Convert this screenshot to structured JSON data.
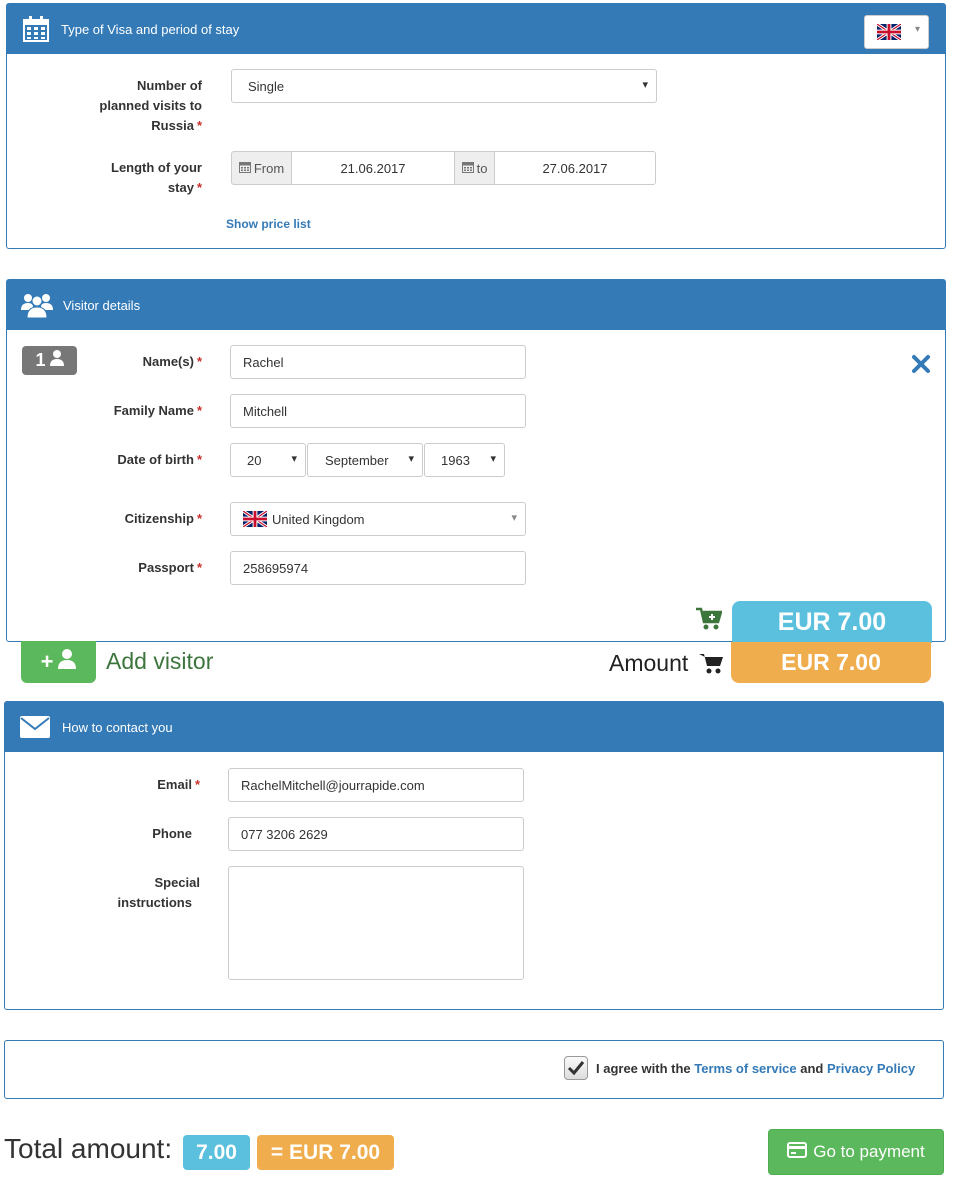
{
  "visa_panel": {
    "title": "Type of Visa and period of stay",
    "visits_label": "Number of planned visits to Russia",
    "visits_value": "Single",
    "stay_label": "Length of your stay",
    "from_label": "From",
    "from_date": "21.06.2017",
    "to_label": "to",
    "to_date": "27.06.2017",
    "price_list_link": "Show price list",
    "language_flag": "uk-flag-icon"
  },
  "visitor_panel": {
    "title": "Visitor details",
    "visitor_number": "1",
    "name_label": "Name(s)",
    "name_value": "Rachel",
    "family_label": "Family Name",
    "family_value": "Mitchell",
    "dob_label": "Date of birth",
    "dob_day": "20",
    "dob_month": "September",
    "dob_year": "1963",
    "citizenship_label": "Citizenship",
    "citizenship_value": "United Kingdom",
    "passport_label": "Passport",
    "passport_value": "258695974",
    "visitor_price": "EUR 7.00"
  },
  "summary": {
    "add_visitor": "Add visitor",
    "amount_label": "Amount",
    "amount_value": "EUR 7.00"
  },
  "contact_panel": {
    "title": "How to contact you",
    "email_label": "Email",
    "email_value": "RachelMitchell@jourrapide.com",
    "phone_label": "Phone",
    "phone_value": "077 3206 2629",
    "special_label": "Special instructions",
    "special_value": ""
  },
  "agreement": {
    "checked": true,
    "prefix": "I agree with the",
    "terms": "Terms of service",
    "and": "and",
    "privacy": "Privacy Policy"
  },
  "footer": {
    "total_label": "Total amount:",
    "total_value": "7.00",
    "total_eur": "= EUR 7.00",
    "pay_button": "Go to payment"
  },
  "colors": {
    "primary": "#337ab7",
    "info": "#5bc0de",
    "warning": "#f0ad4e",
    "success": "#5cb85c",
    "required": "#c9302c"
  }
}
